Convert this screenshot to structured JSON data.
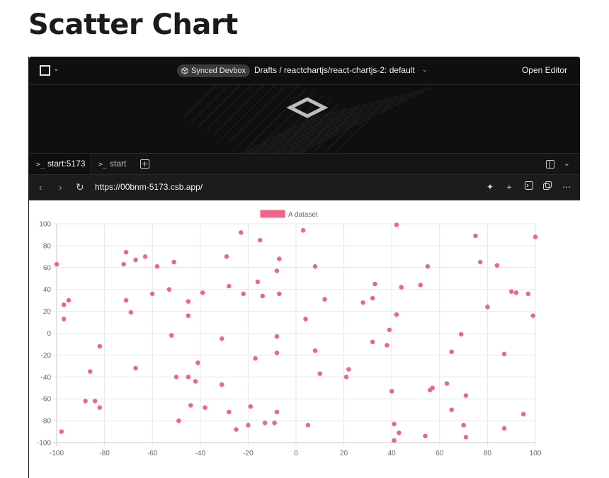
{
  "page": {
    "title": "Scatter Chart"
  },
  "topbar": {
    "devbox_label": "Synced Devbox",
    "breadcrumb": "Drafts  /  reactchartjs/react-chartjs-2: default",
    "open_editor": "Open Editor"
  },
  "tabs": [
    {
      "label": "start:5173"
    },
    {
      "label": "start"
    }
  ],
  "browser": {
    "url": "https://00bnm-5173.csb.app/"
  },
  "icons": {
    "back": "chevron-left-icon",
    "forward": "chevron-right-icon",
    "reload": "reload-icon",
    "sparkle": "sparkle-icon",
    "crosshair": "crosshair-icon",
    "terminal": "terminal-icon",
    "popout": "popout-icon",
    "more": "more-icon"
  },
  "chart_data": {
    "type": "scatter",
    "legend": {
      "position": "top",
      "entries": [
        "A dataset"
      ]
    },
    "series": [
      {
        "name": "A dataset",
        "color": "#f06488",
        "points": [
          [
            -100,
            63
          ],
          [
            -98,
            -90
          ],
          [
            -97,
            26
          ],
          [
            -97,
            13
          ],
          [
            -95,
            30
          ],
          [
            -88,
            -62
          ],
          [
            -86,
            -35
          ],
          [
            -84,
            -62
          ],
          [
            -82,
            -68
          ],
          [
            -82,
            -12
          ],
          [
            -72,
            63
          ],
          [
            -71,
            74
          ],
          [
            -71,
            30
          ],
          [
            -69,
            19
          ],
          [
            -67,
            67
          ],
          [
            -67,
            -32
          ],
          [
            -63,
            70
          ],
          [
            -60,
            36
          ],
          [
            -58,
            61
          ],
          [
            -53,
            40
          ],
          [
            -52,
            -2
          ],
          [
            -51,
            65
          ],
          [
            -50,
            -40
          ],
          [
            -49,
            -80
          ],
          [
            -45,
            29
          ],
          [
            -45,
            16
          ],
          [
            -45,
            -40
          ],
          [
            -44,
            -66
          ],
          [
            -42,
            -44
          ],
          [
            -41,
            -27
          ],
          [
            -39,
            37
          ],
          [
            -38,
            -68
          ],
          [
            -31,
            -5
          ],
          [
            -31,
            -47
          ],
          [
            -29,
            70
          ],
          [
            -28,
            43
          ],
          [
            -28,
            -72
          ],
          [
            -25,
            -88
          ],
          [
            -23,
            92
          ],
          [
            -22,
            36
          ],
          [
            -20,
            -84
          ],
          [
            -19,
            -67
          ],
          [
            -17,
            -23
          ],
          [
            -16,
            47
          ],
          [
            -15,
            85
          ],
          [
            -14,
            34
          ],
          [
            -13,
            -82
          ],
          [
            -9,
            -82
          ],
          [
            -8,
            57
          ],
          [
            -8,
            -3
          ],
          [
            -8,
            -18
          ],
          [
            -8,
            -72
          ],
          [
            -7,
            68
          ],
          [
            -7,
            36
          ],
          [
            3,
            94
          ],
          [
            4,
            13
          ],
          [
            5,
            -84
          ],
          [
            8,
            61
          ],
          [
            8,
            -16
          ],
          [
            10,
            -37
          ],
          [
            12,
            31
          ],
          [
            21,
            -40
          ],
          [
            22,
            -33
          ],
          [
            28,
            28
          ],
          [
            32,
            32
          ],
          [
            32,
            -8
          ],
          [
            33,
            45
          ],
          [
            38,
            -11
          ],
          [
            39,
            3
          ],
          [
            40,
            -53
          ],
          [
            41,
            -98
          ],
          [
            41,
            -83
          ],
          [
            42,
            99
          ],
          [
            42,
            17
          ],
          [
            43,
            -91
          ],
          [
            44,
            42
          ],
          [
            52,
            44
          ],
          [
            54,
            -94
          ],
          [
            55,
            61
          ],
          [
            56,
            -52
          ],
          [
            57,
            -50
          ],
          [
            63,
            -46
          ],
          [
            65,
            -70
          ],
          [
            65,
            -17
          ],
          [
            69,
            -1
          ],
          [
            70,
            -84
          ],
          [
            71,
            -57
          ],
          [
            71,
            -95
          ],
          [
            75,
            89
          ],
          [
            77,
            65
          ],
          [
            80,
            24
          ],
          [
            84,
            62
          ],
          [
            87,
            -87
          ],
          [
            87,
            -19
          ],
          [
            90,
            38
          ],
          [
            92,
            37
          ],
          [
            95,
            -74
          ],
          [
            97,
            36
          ],
          [
            99,
            16
          ],
          [
            100,
            88
          ]
        ]
      }
    ],
    "x": {
      "ticks": [
        -100,
        -80,
        -60,
        -40,
        -20,
        0,
        20,
        40,
        60,
        80,
        100
      ],
      "range": [
        -100,
        100
      ]
    },
    "y": {
      "ticks": [
        100,
        80,
        60,
        40,
        20,
        0,
        -20,
        -40,
        -60,
        -80,
        -100
      ],
      "range": [
        -100,
        100
      ]
    },
    "grid": true
  }
}
